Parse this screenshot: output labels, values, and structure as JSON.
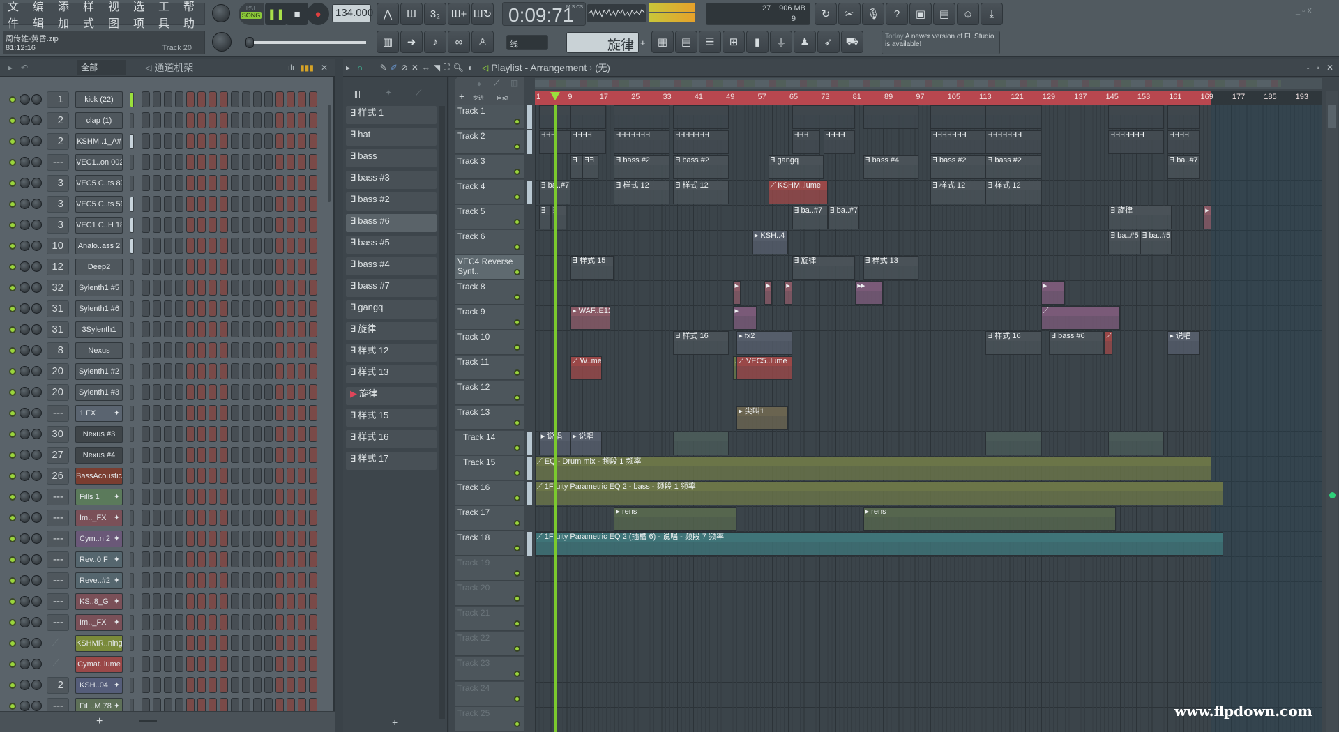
{
  "menu": [
    "文件",
    "编辑",
    "添加",
    "样式",
    "视图",
    "选项",
    "工具",
    "帮助"
  ],
  "song": {
    "file": "周传雄-黄昏.zip",
    "position": "81:12:16",
    "hint": "Track 20"
  },
  "transport": {
    "pat": "PAT",
    "song": "SONG",
    "tempo": "134.000",
    "time": "0:09:71",
    "time_unit": "M:S:CS",
    "mode": "song"
  },
  "monitor": {
    "cpu": "27",
    "memory": "906 MB",
    "polyphony": "9"
  },
  "snap": "线",
  "pattern_selector": "旋律",
  "news": {
    "when": "Today",
    "text": "A newer version of FL Studio is available!"
  },
  "toolbar1_icons": [
    "metronome-icon",
    "wait-icon",
    "countdown-icon",
    "step-edit-icon",
    "loop-record-icon"
  ],
  "toolbar2_icons": [
    "piano-roll-icon",
    "arrow-icon",
    "brush-icon",
    "link-icon",
    "stamp-icon"
  ],
  "toolbar3_icons": [
    "undo-icon",
    "cut-icon",
    "mic-icon",
    "help-icon",
    "save-icon",
    "export-icon",
    "chat-icon",
    "download-icon"
  ],
  "toolbar4_icons": [
    "playlist-icon",
    "channel-rack-icon",
    "mixer-icon",
    "browser-icon",
    "project-icon",
    "plugin-icon",
    "touch-icon",
    "bird-icon",
    "cart-icon"
  ],
  "rack": {
    "filter": "全部",
    "title": "通道机架"
  },
  "playlist": {
    "title": "Playlist - Arrangement",
    "selector": "(无)",
    "label_step": "步进",
    "label_auto": "自动"
  },
  "channels": [
    {
      "num": "1",
      "name": "kick (22)",
      "color": "#4f575d",
      "sel": "#9be03c"
    },
    {
      "num": "2",
      "name": "clap (1)",
      "color": "#4f575d"
    },
    {
      "num": "2",
      "name": "KSHM..1_A#",
      "color": "#4f575d",
      "sel": "#c8d4dc"
    },
    {
      "num": "---",
      "name": "VEC1..on 002",
      "color": "#4f575d"
    },
    {
      "num": "3",
      "name": "VEC5 C..ts 87",
      "color": "#4f575d"
    },
    {
      "num": "3",
      "name": "VEC5 C..ts 59",
      "color": "#4f575d",
      "sel": "#c8d4dc"
    },
    {
      "num": "3",
      "name": "VEC1 C..H 18",
      "color": "#4f575d",
      "sel": "#c8d4dc"
    },
    {
      "num": "10",
      "name": "Analo..ass 2",
      "color": "#4f575d",
      "sel": "#c8d4dc"
    },
    {
      "num": "12",
      "name": "Deep2",
      "color": "#4f575d"
    },
    {
      "num": "32",
      "name": "Sylenth1 #5",
      "color": "#4f575d"
    },
    {
      "num": "31",
      "name": "Sylenth1 #6",
      "color": "#4f575d"
    },
    {
      "num": "31",
      "name": "3Sylenth1",
      "color": "#4f575d"
    },
    {
      "num": "8",
      "name": "Nexus",
      "color": "#4f575d"
    },
    {
      "num": "20",
      "name": "Sylenth1 #2",
      "color": "#4f575d"
    },
    {
      "num": "20",
      "name": "Sylenth1 #3",
      "color": "#4f575d"
    },
    {
      "num": "---",
      "name": "1 FX",
      "color": "#5a6470",
      "audio": true
    },
    {
      "num": "30",
      "name": "Nexus #3",
      "color": "#3f4549"
    },
    {
      "num": "27",
      "name": "Nexus #4",
      "color": "#3f4549"
    },
    {
      "num": "26",
      "name": "BassAcoustic",
      "color": "#7a3d30"
    },
    {
      "num": "---",
      "name": "Fills 1",
      "color": "#5b7a5b",
      "audio": true
    },
    {
      "num": "---",
      "name": "Im.._FX",
      "color": "#7a5058",
      "audio": true
    },
    {
      "num": "---",
      "name": "Cym..n 2",
      "color": "#6a5878",
      "audio": true
    },
    {
      "num": "---",
      "name": "Rev..0 F",
      "color": "#55666e",
      "audio": true
    },
    {
      "num": "---",
      "name": "Reve..#2",
      "color": "#55666e",
      "audio": true
    },
    {
      "num": "---",
      "name": "KS..8_G",
      "color": "#7a5058",
      "audio": true
    },
    {
      "num": "---",
      "name": "Im.._FX",
      "color": "#7a5058",
      "audio": true
    },
    {
      "num": "",
      "name": "KSHMR..ning",
      "color": "#7a8a3a",
      "link": true
    },
    {
      "num": "",
      "name": "Cymat..lume",
      "color": "#9a4848",
      "link": true
    },
    {
      "num": "2",
      "name": "KSH..04",
      "color": "#555d7a",
      "audio": true
    },
    {
      "num": "---",
      "name": "FiL..M 78",
      "color": "#5e7058",
      "audio": true
    }
  ],
  "patterns": [
    "样式 1",
    "hat",
    "bass",
    "bass #3",
    "bass #2",
    "bass #6",
    "bass #5",
    "bass #4",
    "bass #7",
    "gangq",
    "旋律",
    "样式 12",
    "样式 13",
    "旋律",
    "样式 15",
    "样式 16",
    "样式 17"
  ],
  "current_pattern_index": 13,
  "tracks": [
    "Track 1",
    "Track 2",
    "Track 3",
    "Track 4",
    "Track 5",
    "Track 6",
    "VEC4 Reverse Synt..",
    "Track 8",
    "Track 9",
    "Track 10",
    "Track 11",
    "Track 12",
    "Track 13",
    "Track 14",
    "Track 15",
    "Track 16",
    "Track 17",
    "Track 18",
    "Track 19",
    "Track 20",
    "Track 21",
    "Track 22",
    "Track 23",
    "Track 24",
    "Track 25"
  ],
  "ruler_bars": [
    1,
    9,
    17,
    25,
    33,
    41,
    49,
    57,
    65,
    73,
    81,
    89,
    97,
    105,
    113,
    121,
    129,
    137,
    145,
    153,
    161,
    169,
    177,
    185,
    193
  ],
  "song_end_bar": 172,
  "playhead_bar": 6,
  "clips": [
    {
      "t": 1,
      "s": 2,
      "l": 8,
      "n": "",
      "c": "#3f474d"
    },
    {
      "t": 1,
      "s": 10,
      "l": 9,
      "n": "",
      "c": "#3f474d"
    },
    {
      "t": 1,
      "s": 21,
      "l": 14,
      "n": "",
      "c": "#3f474d"
    },
    {
      "t": 1,
      "s": 36,
      "l": 14,
      "n": "",
      "c": "#3f474d"
    },
    {
      "t": 1,
      "s": 66,
      "l": 16,
      "n": "",
      "c": "#3f474d"
    },
    {
      "t": 1,
      "s": 84,
      "l": 14,
      "n": "",
      "c": "#3f474d"
    },
    {
      "t": 1,
      "s": 101,
      "l": 14,
      "n": "",
      "c": "#3f474d"
    },
    {
      "t": 1,
      "s": 115,
      "l": 14,
      "n": "",
      "c": "#3f474d"
    },
    {
      "t": 1,
      "s": 146,
      "l": 14,
      "n": "",
      "c": "#3f474d"
    },
    {
      "t": 1,
      "s": 161,
      "l": 8,
      "n": "",
      "c": "#3f474d"
    },
    {
      "t": 2,
      "s": 2,
      "l": 8,
      "n": "∃∃∃",
      "c": "#434b51"
    },
    {
      "t": 2,
      "s": 10,
      "l": 9,
      "n": "∃∃∃∃",
      "c": "#434b51"
    },
    {
      "t": 2,
      "s": 21,
      "l": 14,
      "n": "∃∃∃∃∃∃∃",
      "c": "#434b51"
    },
    {
      "t": 2,
      "s": 36,
      "l": 14,
      "n": "∃∃∃∃∃∃∃",
      "c": "#434b51"
    },
    {
      "t": 2,
      "s": 66,
      "l": 7,
      "n": "∃∃∃",
      "c": "#434b51"
    },
    {
      "t": 2,
      "s": 74,
      "l": 8,
      "n": "∃∃∃∃",
      "c": "#434b51"
    },
    {
      "t": 2,
      "s": 101,
      "l": 14,
      "n": "∃∃∃∃∃∃∃",
      "c": "#434b51"
    },
    {
      "t": 2,
      "s": 115,
      "l": 14,
      "n": "∃∃∃∃∃∃∃",
      "c": "#434b51"
    },
    {
      "t": 2,
      "s": 146,
      "l": 14,
      "n": "∃∃∃∃∃∃∃",
      "c": "#434b51"
    },
    {
      "t": 2,
      "s": 161,
      "l": 8,
      "n": "∃∃∃∃",
      "c": "#434b51"
    },
    {
      "t": 3,
      "s": 10,
      "l": 3,
      "n": "∃",
      "c": "#4a5258"
    },
    {
      "t": 3,
      "s": 13,
      "l": 4,
      "n": "∃∃",
      "c": "#4a5258"
    },
    {
      "t": 3,
      "s": 21,
      "l": 14,
      "n": "∃ bass #2",
      "c": "#4a5258"
    },
    {
      "t": 3,
      "s": 36,
      "l": 14,
      "n": "∃ bass #2",
      "c": "#4a5258"
    },
    {
      "t": 3,
      "s": 60,
      "l": 14,
      "n": "∃ gangq",
      "c": "#4a5258"
    },
    {
      "t": 3,
      "s": 84,
      "l": 14,
      "n": "∃ bass #4",
      "c": "#4a5258"
    },
    {
      "t": 3,
      "s": 101,
      "l": 14,
      "n": "∃ bass #2",
      "c": "#4a5258"
    },
    {
      "t": 3,
      "s": 115,
      "l": 14,
      "n": "∃ bass #2",
      "c": "#4a5258"
    },
    {
      "t": 3,
      "s": 161,
      "l": 8,
      "n": "∃ ba..#7",
      "c": "#4a5258"
    },
    {
      "t": 4,
      "s": 2,
      "l": 8,
      "n": "∃ ba..#7",
      "c": "#4a5258"
    },
    {
      "t": 4,
      "s": 21,
      "l": 14,
      "n": "∃ 样式 12",
      "c": "#4a5258"
    },
    {
      "t": 4,
      "s": 36,
      "l": 14,
      "n": "∃ 样式 12",
      "c": "#4a5258"
    },
    {
      "t": 4,
      "s": 60,
      "l": 15,
      "n": "⟋ KSHM..lume",
      "c": "#9a4848"
    },
    {
      "t": 4,
      "s": 101,
      "l": 14,
      "n": "∃ 样式 12",
      "c": "#4a5258"
    },
    {
      "t": 4,
      "s": 115,
      "l": 14,
      "n": "∃ 样式 12",
      "c": "#4a5258"
    },
    {
      "t": 5,
      "s": 2,
      "l": 3,
      "n": "∃",
      "c": "#4a5258"
    },
    {
      "t": 5,
      "s": 5,
      "l": 4,
      "n": "∃",
      "c": "#4a5258"
    },
    {
      "t": 5,
      "s": 66,
      "l": 9,
      "n": "∃ ba..#7",
      "c": "#4a5258"
    },
    {
      "t": 5,
      "s": 75,
      "l": 8,
      "n": "∃ ba..#7",
      "c": "#4a5258"
    },
    {
      "t": 5,
      "s": 146,
      "l": 16,
      "n": "∃ 旋律",
      "c": "#4a5258"
    },
    {
      "t": 5,
      "s": 170,
      "l": 2,
      "n": "▸",
      "c": "#8a5a66"
    },
    {
      "t": 6,
      "s": 56,
      "l": 9,
      "n": "▸ KSH..4",
      "c": "#555d6a"
    },
    {
      "t": 6,
      "s": 146,
      "l": 8,
      "n": "∃ ba..#5",
      "c": "#4a5258"
    },
    {
      "t": 6,
      "s": 154,
      "l": 8,
      "n": "∃ ba..#5",
      "c": "#4a5258"
    },
    {
      "t": 7,
      "s": 10,
      "l": 11,
      "n": "∃ 样式 15",
      "c": "#4a5258"
    },
    {
      "t": 7,
      "s": 66,
      "l": 16,
      "n": "∃ 旋律",
      "c": "#4a5258"
    },
    {
      "t": 7,
      "s": 84,
      "l": 14,
      "n": "∃ 样式 13",
      "c": "#4a5258"
    },
    {
      "t": 8,
      "s": 51,
      "l": 2,
      "n": "▸",
      "c": "#8a5a66"
    },
    {
      "t": 8,
      "s": 59,
      "l": 2,
      "n": "▸",
      "c": "#8a5a66"
    },
    {
      "t": 8,
      "s": 64,
      "l": 2,
      "n": "▸",
      "c": "#8a5a66"
    },
    {
      "t": 8,
      "s": 82,
      "l": 7,
      "n": "▸▸",
      "c": "#7a5a78"
    },
    {
      "t": 8,
      "s": 129,
      "l": 6,
      "n": "▸",
      "c": "#7a5a78"
    },
    {
      "t": 9,
      "s": 10,
      "l": 10,
      "n": "▸ WAF..E12",
      "c": "#8a5a66"
    },
    {
      "t": 9,
      "s": 51,
      "l": 6,
      "n": "▸",
      "c": "#7a5a78"
    },
    {
      "t": 9,
      "s": 129,
      "l": 20,
      "n": "⟋",
      "c": "#7a5a78"
    },
    {
      "t": 10,
      "s": 36,
      "l": 14,
      "n": "∃ 样式 16",
      "c": "#4a5258"
    },
    {
      "t": 10,
      "s": 52,
      "l": 14,
      "n": "▸ fx2",
      "c": "#555d6a"
    },
    {
      "t": 10,
      "s": 115,
      "l": 14,
      "n": "∃ 样式 16",
      "c": "#4a5258"
    },
    {
      "t": 10,
      "s": 131,
      "l": 14,
      "n": "∃ bass #6",
      "c": "#4a5258"
    },
    {
      "t": 10,
      "s": 145,
      "l": 2,
      "n": "⟋",
      "c": "#9a4848"
    },
    {
      "t": 10,
      "s": 161,
      "l": 8,
      "n": "▸ 说唱",
      "c": "#555d6a"
    },
    {
      "t": 11,
      "s": 10,
      "l": 8,
      "n": "⟋ W..me",
      "c": "#9a4848"
    },
    {
      "t": 11,
      "s": 51,
      "l": 1,
      "n": "⟋",
      "c": "#6a7a48"
    },
    {
      "t": 11,
      "s": 52,
      "l": 14,
      "n": "⟋ VEC5..lume",
      "c": "#9a4848"
    },
    {
      "t": 13,
      "s": 52,
      "l": 13,
      "n": "▸ 尖叫1",
      "c": "#6a6450"
    },
    {
      "t": 14,
      "s": 2,
      "l": 8,
      "n": "▸ 说唱",
      "c": "#555d6a"
    },
    {
      "t": 14,
      "s": 10,
      "l": 8,
      "n": "▸ 说唱",
      "c": "#555d6a"
    },
    {
      "t": 14,
      "s": 36,
      "l": 14,
      "n": "",
      "c": "#4a5a58"
    },
    {
      "t": 14,
      "s": 115,
      "l": 14,
      "n": "",
      "c": "#4a5a58"
    },
    {
      "t": 14,
      "s": 146,
      "l": 14,
      "n": "",
      "c": "#4a5a58"
    },
    {
      "t": 15,
      "s": 1,
      "l": 171,
      "n": "⟋ EQ - Drum mix - 频段 1 频率",
      "c": "#6b7548"
    },
    {
      "t": 16,
      "s": 1,
      "l": 174,
      "n": "⟋ 1Fruity Parametric EQ 2 - bass - 频段 1 频率",
      "c": "#6b7548"
    },
    {
      "t": 17,
      "s": 21,
      "l": 31,
      "n": "▸ rens",
      "c": "#56664e"
    },
    {
      "t": 17,
      "s": 84,
      "l": 64,
      "n": "▸ rens",
      "c": "#56664e"
    },
    {
      "t": 18,
      "s": 1,
      "l": 174,
      "n": "⟋ 1Fruity Parametric EQ 2 (插槽 6) - 说唱 - 频段 7 频率",
      "c": "#3f7478"
    }
  ],
  "watermark": "www.flpdown.com",
  "colors": {
    "accent": "#9be03c",
    "ruler": "#b8474f",
    "step_red": "#7a4a48",
    "step_gray": "#474e54"
  }
}
